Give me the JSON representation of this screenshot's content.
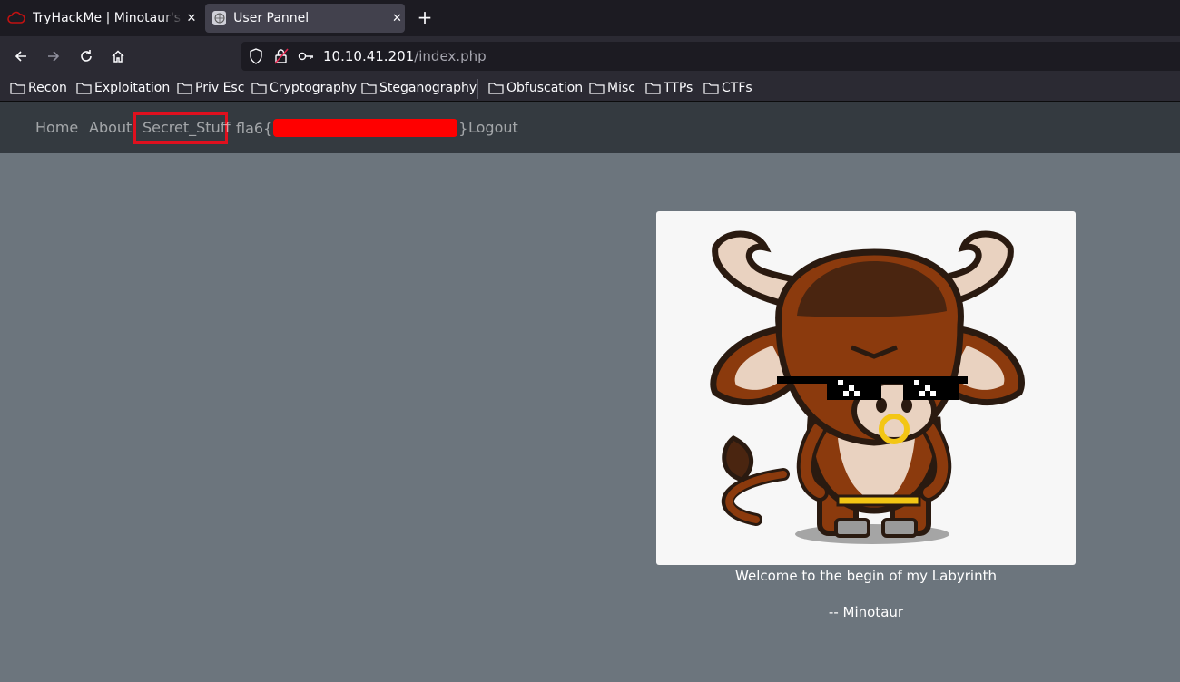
{
  "browser": {
    "tabs": [
      {
        "title": "TryHackMe | Minotaur's Labyrinth",
        "active": false
      },
      {
        "title": "User Pannel",
        "active": true
      }
    ],
    "url": {
      "host": "10.10.41.201",
      "path": "/index.php"
    },
    "bookmarks": [
      "Recon",
      "Exploitation",
      "Priv Esc",
      "Cryptography",
      "Steganography",
      "Obfuscation",
      "Misc",
      "TTPs",
      "CTFs"
    ]
  },
  "site_nav": {
    "home": "Home",
    "about": "About",
    "secret": "Secret_Stuff",
    "flag_prefix": "fla6{",
    "flag_suffix": "}",
    "logout": "Logout"
  },
  "main": {
    "image_subject": "cartoon minotaur with pixel sunglasses",
    "welcome": "Welcome to the begin of my Labyrinth",
    "signature": "-- Minotaur"
  },
  "colors": {
    "page_bg": "#6c757d",
    "nav_bg": "#343a40",
    "highlight": "#e0101e",
    "redaction": "#ff0000"
  }
}
